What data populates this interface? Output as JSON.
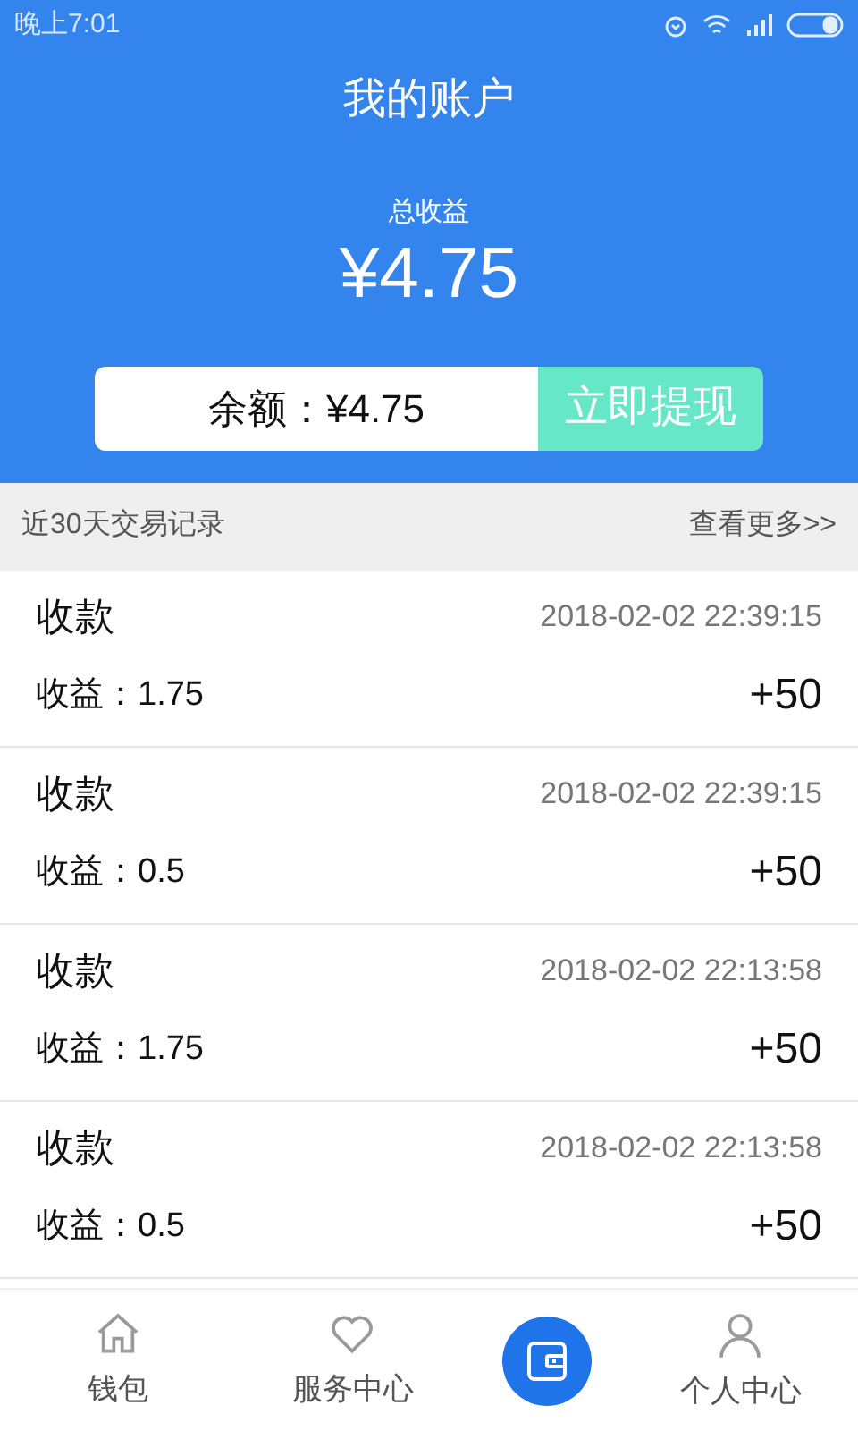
{
  "status_bar": {
    "time": "晚上7:01"
  },
  "header": {
    "title": "我的账户",
    "total_label": "总收益",
    "total": "¥4.75",
    "balance": "余额：¥4.75",
    "withdraw_button": "立即提现"
  },
  "records_bar": {
    "title": "近30天交易记录",
    "more_link": "查看更多>>"
  },
  "records": [
    {
      "type": "收款",
      "time": "2018-02-02 22:39:15",
      "earning": "收益：1.75",
      "amount": "+50"
    },
    {
      "type": "收款",
      "time": "2018-02-02 22:39:15",
      "earning": "收益：0.5",
      "amount": "+50"
    },
    {
      "type": "收款",
      "time": "2018-02-02 22:13:58",
      "earning": "收益：1.75",
      "amount": "+50"
    },
    {
      "type": "收款",
      "time": "2018-02-02 22:13:58",
      "earning": "收益：0.5",
      "amount": "+50"
    }
  ],
  "tab_bar": [
    {
      "kind": "home",
      "label": "钱包",
      "selected": false
    },
    {
      "kind": "heart",
      "label": "服务中心",
      "selected": false
    },
    {
      "kind": "wallet",
      "selected": true
    },
    {
      "kind": "person",
      "label": "个人中心",
      "selected": false
    }
  ]
}
